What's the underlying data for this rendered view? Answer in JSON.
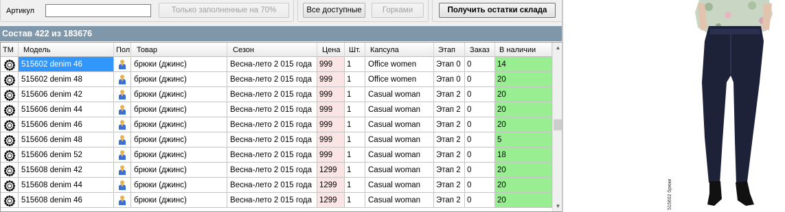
{
  "toolbar": {
    "article_label": "Артикул",
    "article_value": "",
    "filled_button": "Только заполненные на 70%",
    "all_available_button": "Все доступные",
    "gorki_button": "Горками",
    "get_stock_button": "Получить остатки склада"
  },
  "title": "Состав 422 из 183676",
  "columns": [
    "ТМ",
    "Модель",
    "Пол",
    "Товар",
    "Сезон",
    "Цена",
    "Шт.",
    "Капсула",
    "Этап",
    "Заказ",
    "В наличии"
  ],
  "rows": [
    {
      "model": "515602 denim  46",
      "gender": "male-icon",
      "item": "брюки (джинс)",
      "season": "Весна-лето 2 015 года",
      "price": "999",
      "qty": "1",
      "capsule": "Office women",
      "stage": "Этап 0",
      "order": "0",
      "stock": "14"
    },
    {
      "model": "515602 denim  48",
      "gender": "male-icon",
      "item": "брюки (джинс)",
      "season": "Весна-лето 2 015 года",
      "price": "999",
      "qty": "1",
      "capsule": "Office women",
      "stage": "Этап 0",
      "order": "0",
      "stock": "20"
    },
    {
      "model": "515606 denim  42",
      "gender": "male-icon",
      "item": "брюки (джинс)",
      "season": "Весна-лето 2 015 года",
      "price": "999",
      "qty": "1",
      "capsule": "Casual woman",
      "stage": "Этап 2",
      "order": "0",
      "stock": "20"
    },
    {
      "model": "515606 denim  44",
      "gender": "male-icon",
      "item": "брюки (джинс)",
      "season": "Весна-лето 2 015 года",
      "price": "999",
      "qty": "1",
      "capsule": "Casual woman",
      "stage": "Этап 2",
      "order": "0",
      "stock": "20"
    },
    {
      "model": "515606 denim  46",
      "gender": "male-icon",
      "item": "брюки (джинс)",
      "season": "Весна-лето 2 015 года",
      "price": "999",
      "qty": "1",
      "capsule": "Casual woman",
      "stage": "Этап 2",
      "order": "0",
      "stock": "20"
    },
    {
      "model": "515606 denim  48",
      "gender": "male-icon",
      "item": "брюки (джинс)",
      "season": "Весна-лето 2 015 года",
      "price": "999",
      "qty": "1",
      "capsule": "Casual woman",
      "stage": "Этап 2",
      "order": "0",
      "stock": "5"
    },
    {
      "model": "515606 denim  52",
      "gender": "male-icon",
      "item": "брюки (джинс)",
      "season": "Весна-лето 2 015 года",
      "price": "999",
      "qty": "1",
      "capsule": "Casual woman",
      "stage": "Этап 2",
      "order": "0",
      "stock": "18"
    },
    {
      "model": "515608 denim  42",
      "gender": "male-icon",
      "item": "брюки (джинс)",
      "season": "Весна-лето 2 015 года",
      "price": "1299",
      "qty": "1",
      "capsule": "Casual woman",
      "stage": "Этап 2",
      "order": "0",
      "stock": "20"
    },
    {
      "model": "515608 denim  44",
      "gender": "male-icon",
      "item": "брюки (джинс)",
      "season": "Весна-лето 2 015 года",
      "price": "1299",
      "qty": "1",
      "capsule": "Casual woman",
      "stage": "Этап 2",
      "order": "0",
      "stock": "20"
    },
    {
      "model": "515608 denim  46",
      "gender": "male-icon",
      "item": "брюки (джинс)",
      "season": "Весна-лето 2 015 года",
      "price": "1299",
      "qty": "1",
      "capsule": "Casual woman",
      "stage": "Этап 2",
      "order": "0",
      "stock": "20"
    }
  ],
  "photo_caption": "515602 брюки",
  "colors": {
    "title_bar": "#7f97aa",
    "price_cell": "#fbe4e4",
    "stock_cell": "#98ee90",
    "selection": "#3297fd"
  }
}
